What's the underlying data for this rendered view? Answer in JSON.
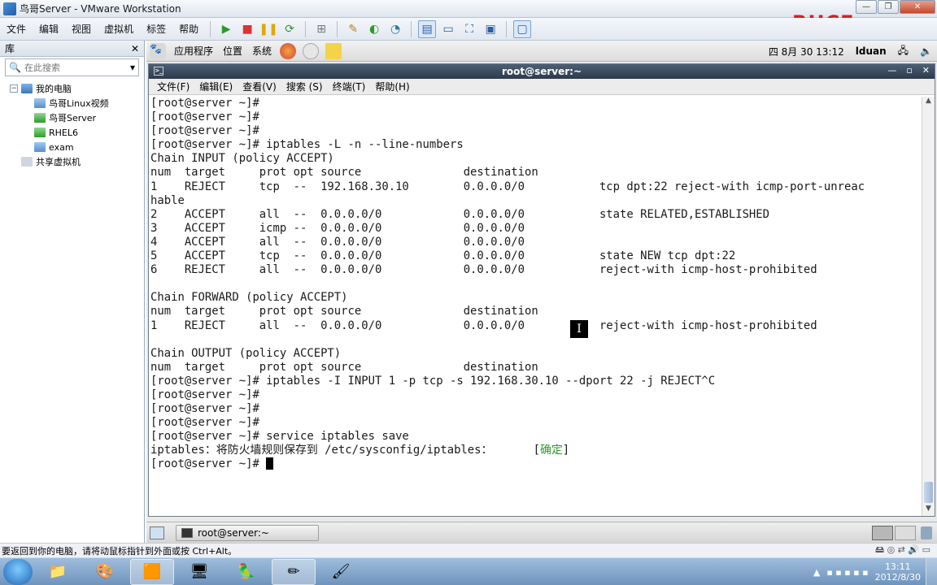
{
  "vmware": {
    "title": "鸟哥Server - VMware Workstation",
    "brand": "RHCE.cc",
    "menu": [
      "文件",
      "编辑",
      "视图",
      "虚拟机",
      "标签",
      "帮助"
    ],
    "status_text": "要返回到你的电脑，请将动鼠标指针到外面或按 Ctrl+Alt。"
  },
  "library": {
    "header": "库",
    "search_placeholder": "在此搜索",
    "root": "我的电脑",
    "vms": [
      "鸟哥Linux视频",
      "鸟哥Server",
      "RHEL6",
      "exam"
    ],
    "shared": "共享虚拟机"
  },
  "guest_panel": {
    "apps": "应用程序",
    "places": "位置",
    "system": "系统",
    "datetime": "四 8月 30 13:12",
    "user": "lduan"
  },
  "terminal": {
    "title": "root@server:~",
    "menu": [
      "文件(F)",
      "编辑(E)",
      "查看(V)",
      "搜索 (S)",
      "终端(T)",
      "帮助(H)"
    ],
    "lines": [
      "[root@server ~]#",
      "[root@server ~]#",
      "[root@server ~]#",
      "[root@server ~]# iptables -L -n --line-numbers",
      "Chain INPUT (policy ACCEPT)",
      "num  target     prot opt source               destination",
      "1    REJECT     tcp  --  192.168.30.10        0.0.0.0/0           tcp dpt:22 reject-with icmp-port-unreac",
      "hable",
      "2    ACCEPT     all  --  0.0.0.0/0            0.0.0.0/0           state RELATED,ESTABLISHED",
      "3    ACCEPT     icmp --  0.0.0.0/0            0.0.0.0/0",
      "4    ACCEPT     all  --  0.0.0.0/0            0.0.0.0/0",
      "5    ACCEPT     tcp  --  0.0.0.0/0            0.0.0.0/0           state NEW tcp dpt:22",
      "6    REJECT     all  --  0.0.0.0/0            0.0.0.0/0           reject-with icmp-host-prohibited",
      "",
      "Chain FORWARD (policy ACCEPT)",
      "num  target     prot opt source               destination",
      "1    REJECT     all  --  0.0.0.0/0            0.0.0.0/0           reject-with icmp-host-prohibited",
      "",
      "Chain OUTPUT (policy ACCEPT)",
      "num  target     prot opt source               destination",
      "[root@server ~]# iptables -I INPUT 1 -p tcp -s 192.168.30.10 --dport 22 -j REJECT^C",
      "[root@server ~]#",
      "[root@server ~]#",
      "[root@server ~]#",
      "[root@server ~]# service iptables save"
    ],
    "save_line_prefix": "iptables：将防火墙规则保存到 /etc/sysconfig/iptables：      [",
    "save_ok": "确定",
    "save_line_suffix": "]",
    "prompt": "[root@server ~]# "
  },
  "guest_taskbar": {
    "task": "root@server:~"
  },
  "windows_taskbar": {
    "time": "13:11",
    "date": "2012/8/30"
  }
}
